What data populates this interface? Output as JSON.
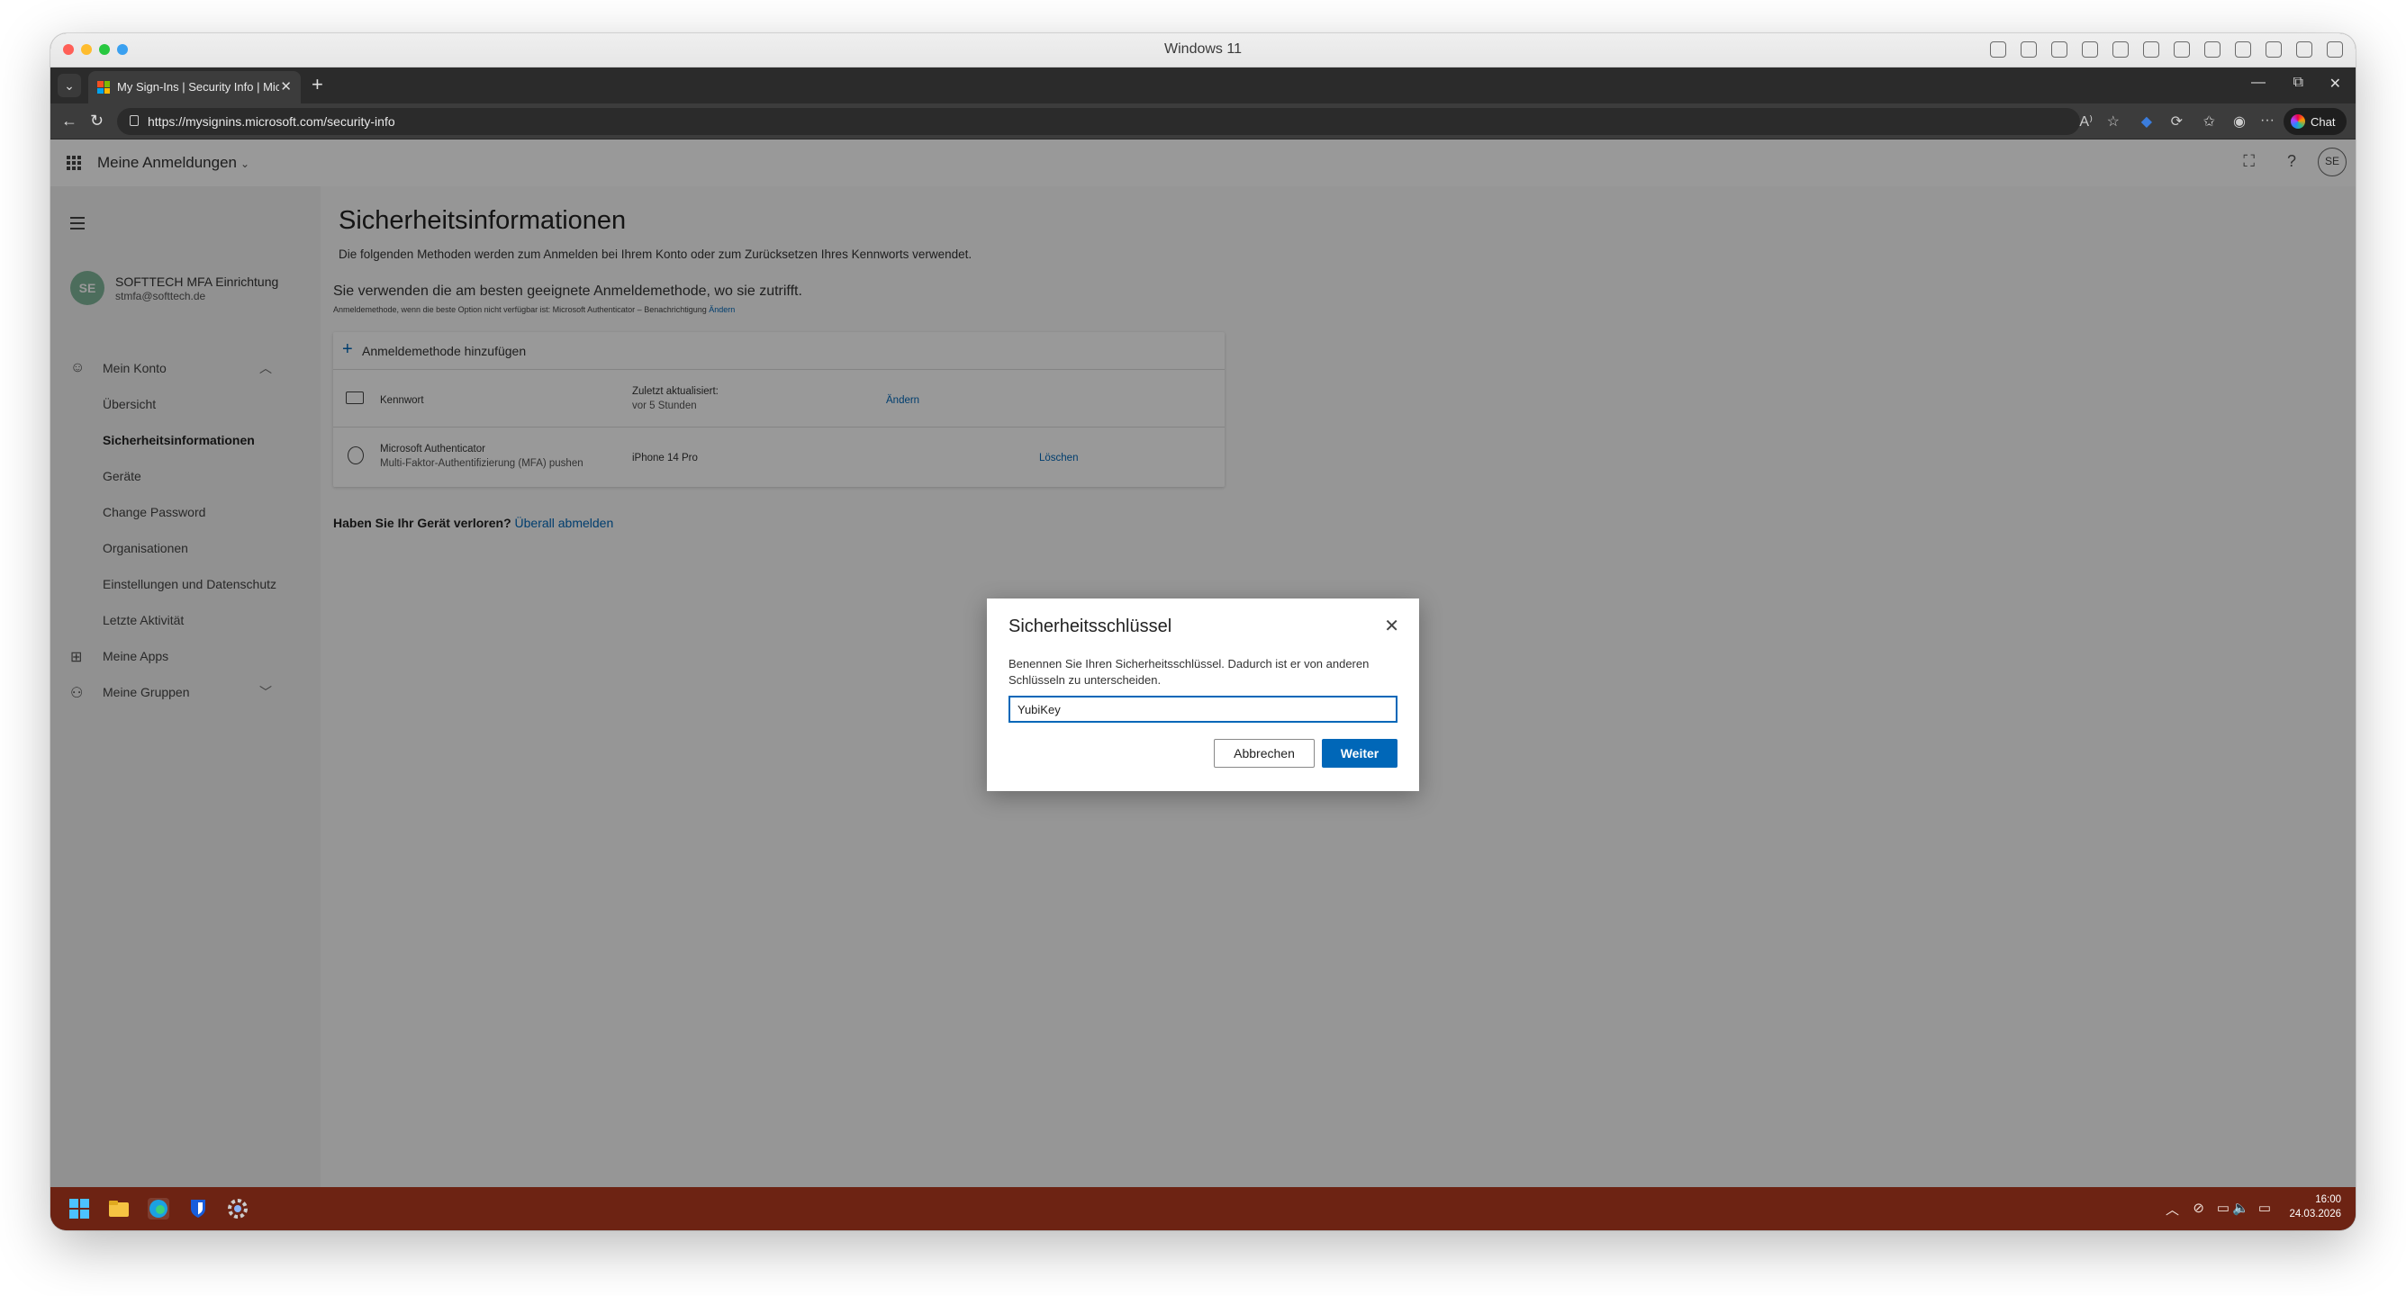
{
  "mac": {
    "window_title": "Windows 11"
  },
  "browser": {
    "tab_title": "My Sign-Ins | Security Info | Micro",
    "url": "https://mysignins.microsoft.com/security-info",
    "chat_label": "Chat"
  },
  "header": {
    "app_name": "Meine Anmeldungen",
    "avatar_initials": "SE"
  },
  "sidebar": {
    "user": {
      "initials": "SE",
      "name": "SOFTTECH MFA Einrichtung",
      "email": "stmfa@softtech.de"
    },
    "items": [
      {
        "label": "Mein Konto"
      },
      {
        "label": "Übersicht"
      },
      {
        "label": "Sicherheitsinformationen"
      },
      {
        "label": "Geräte"
      },
      {
        "label": "Change Password"
      },
      {
        "label": "Organisationen"
      },
      {
        "label": "Einstellungen und Datenschutz"
      },
      {
        "label": "Letzte Aktivität"
      },
      {
        "label": "Meine Apps"
      },
      {
        "label": "Meine Gruppen"
      }
    ]
  },
  "main": {
    "title": "Sicherheitsinformationen",
    "intro": "Die folgenden Methoden werden zum Anmelden bei Ihrem Konto oder zum Zurücksetzen Ihres Kennworts verwendet.",
    "recommendation": "Sie verwenden die am besten geeignete Anmeldemethode, wo sie zutrifft.",
    "default_method": "Anmeldemethode, wenn die beste Option nicht verfügbar ist: Microsoft Authenticator – Benachrichtigung",
    "default_method_link": "Ändern",
    "add_method": "Anmeldemethode hinzufügen",
    "methods": [
      {
        "name": "Kennwort",
        "detail_label": "Zuletzt aktualisiert:",
        "detail_value": "vor 5 Stunden",
        "action": "Ändern"
      },
      {
        "name": "Microsoft Authenticator",
        "subtitle": "Multi-Faktor-Authentifizierung (MFA) pushen",
        "detail_value": "iPhone 14 Pro",
        "action": "Löschen"
      }
    ],
    "lost_device_text": "Haben Sie Ihr Gerät verloren?",
    "lost_device_link": "Überall abmelden"
  },
  "dialog": {
    "title": "Sicherheitsschlüssel",
    "description": "Benennen Sie Ihren Sicherheitsschlüssel. Dadurch ist er von anderen Schlüsseln zu unterscheiden.",
    "input_value": "YubiKey",
    "cancel_label": "Abbrechen",
    "next_label": "Weiter"
  },
  "taskbar": {
    "time": "16:00",
    "date": "24.03.2026"
  },
  "colors": {
    "accent": "#0067b8",
    "taskbar": "#6d2313"
  }
}
